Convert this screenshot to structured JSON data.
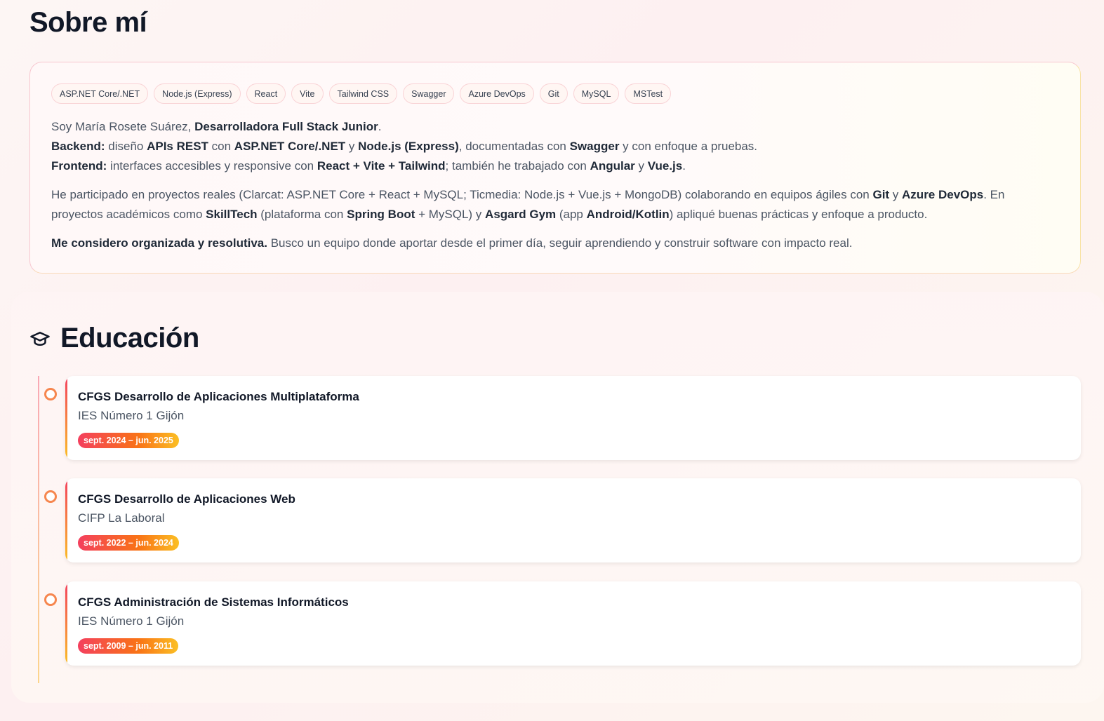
{
  "about": {
    "title": "Sobre mí",
    "chips": [
      "ASP.NET Core/.NET",
      "Node.js (Express)",
      "React",
      "Vite",
      "Tailwind CSS",
      "Swagger",
      "Azure DevOps",
      "Git",
      "MySQL",
      "MSTest"
    ],
    "p1_l1_a": "Soy María Rosete Suárez, ",
    "p1_l1_b": "Desarrolladora Full Stack Junior",
    "p1_l1_c": ".",
    "p1_l2_a": "Backend:",
    "p1_l2_b": " diseño ",
    "p1_l2_c": "APIs REST",
    "p1_l2_d": " con ",
    "p1_l2_e": "ASP.NET Core/.NET",
    "p1_l2_f": " y ",
    "p1_l2_g": "Node.js (Express)",
    "p1_l2_h": ", documentadas con ",
    "p1_l2_i": "Swagger",
    "p1_l2_j": " y con enfoque a pruebas.",
    "p1_l3_a": "Frontend:",
    "p1_l3_b": " interfaces accesibles y responsive con ",
    "p1_l3_c": "React + Vite + Tailwind",
    "p1_l3_d": "; también he trabajado con ",
    "p1_l3_e": "Angular",
    "p1_l3_f": " y ",
    "p1_l3_g": "Vue.js",
    "p1_l3_h": ".",
    "p2_a": "He participado en proyectos reales (Clarcat: ASP.NET Core + React + MySQL; Ticmedia: Node.js + Vue.js + MongoDB) colaborando en equipos ágiles con ",
    "p2_b": "Git",
    "p2_c": " y ",
    "p2_d": "Azure DevOps",
    "p2_e": ". En proyectos académicos como ",
    "p2_f": "SkillTech",
    "p2_g": " (plataforma con ",
    "p2_h": "Spring Boot",
    "p2_i": " + MySQL) y ",
    "p2_j": "Asgard Gym",
    "p2_k": " (app ",
    "p2_l": "Android/Kotlin",
    "p2_m": ") apliqué buenas prácticas y enfoque a producto.",
    "p3_a": "Me considero organizada y resolutiva.",
    "p3_b": " Busco un equipo donde aportar desde el primer día, seguir aprendiendo y construir software con impacto real."
  },
  "education": {
    "title": "Educación",
    "icon": "graduation-cap-icon",
    "items": [
      {
        "degree": "CFGS Desarrollo de Aplicaciones Multiplataforma",
        "school": "IES Número 1 Gijón",
        "dates": "sept. 2024 – jun. 2025"
      },
      {
        "degree": "CFGS Desarrollo de Aplicaciones Web",
        "school": "CIFP La Laboral",
        "dates": "sept. 2022 – jun. 2024"
      },
      {
        "degree": "CFGS Administración de Sistemas Informáticos",
        "school": "IES Número 1 Gijón",
        "dates": "sept. 2009 – jun. 2011"
      }
    ]
  },
  "colors": {
    "accent_start": "#f43f5e",
    "accent_end": "#fbbf24",
    "dot": "#f6864e"
  }
}
